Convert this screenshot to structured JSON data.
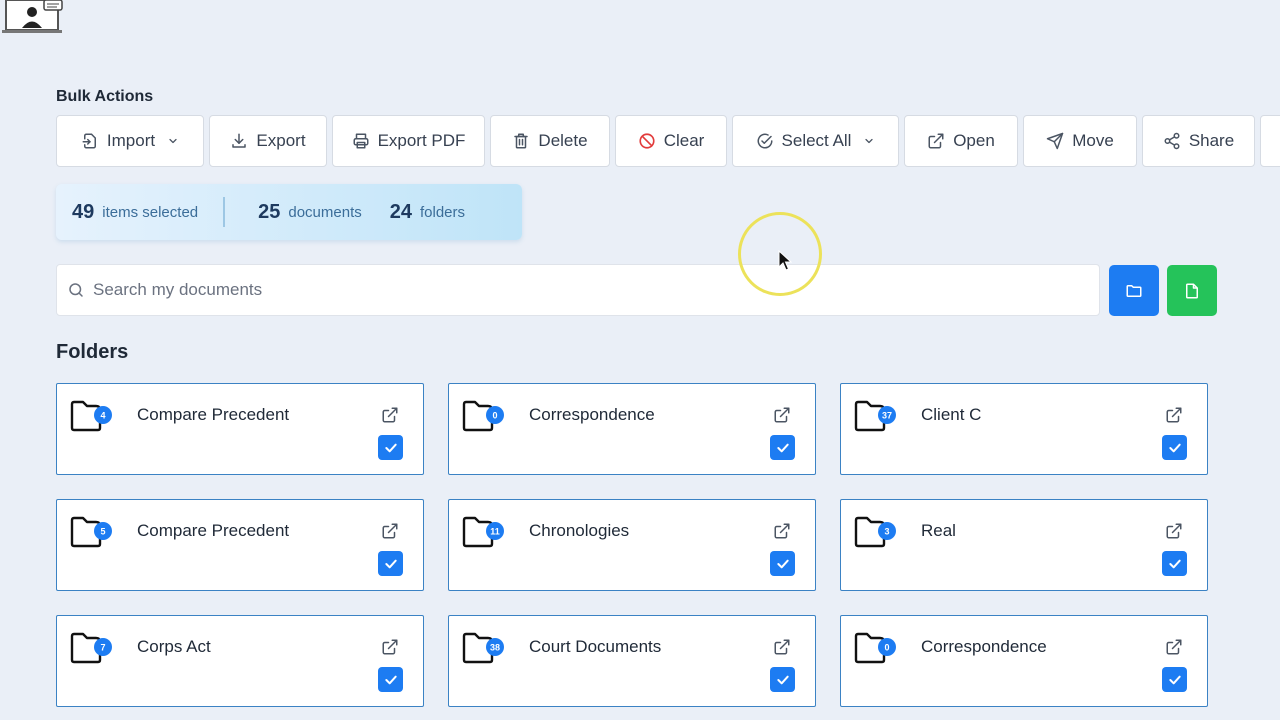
{
  "header": {
    "logo_icon": "presentation-user-icon"
  },
  "bulk_actions": {
    "title": "Bulk Actions",
    "buttons": [
      {
        "label": "Import",
        "icon": "file-import-icon",
        "dropdown": true
      },
      {
        "label": "Export",
        "icon": "download-icon"
      },
      {
        "label": "Export PDF",
        "icon": "printer-icon"
      },
      {
        "label": "Delete",
        "icon": "trash-icon"
      },
      {
        "label": "Clear",
        "icon": "ban-icon",
        "icon_color": "#e23b3b"
      },
      {
        "label": "Select All",
        "icon": "check-circle-icon",
        "dropdown": true
      },
      {
        "label": "Open",
        "icon": "external-link-icon"
      },
      {
        "label": "Move",
        "icon": "send-icon"
      },
      {
        "label": "Share",
        "icon": "share-icon"
      }
    ]
  },
  "selection_summary": {
    "items_count": "49",
    "items_label": "items selected",
    "documents_count": "25",
    "documents_label": "documents",
    "folders_count": "24",
    "folders_label": "folders"
  },
  "search": {
    "placeholder": "Search my documents",
    "value": ""
  },
  "actions": {
    "new_folder_icon": "folder-icon",
    "new_document_icon": "file-icon",
    "folder_color": "#1d7cf2",
    "document_color": "#25c35a"
  },
  "folders": {
    "title": "Folders",
    "items": [
      {
        "name": "Compare Precedent",
        "count": "4",
        "selected": true
      },
      {
        "name": "Correspondence",
        "count": "0",
        "selected": true
      },
      {
        "name": "Client C",
        "count": "37",
        "selected": true
      },
      {
        "name": "Compare Precedent",
        "count": "5",
        "selected": true
      },
      {
        "name": "Chronologies",
        "count": "11",
        "selected": true
      },
      {
        "name": "Real",
        "count": "3",
        "selected": true
      },
      {
        "name": "Corps Act",
        "count": "7",
        "selected": true
      },
      {
        "name": "Court Documents",
        "count": "38",
        "selected": true
      },
      {
        "name": "Correspondence",
        "count": "0",
        "selected": true
      }
    ]
  },
  "colors": {
    "accent": "#1d7cf2",
    "card_border": "#3b82c4",
    "background": "#eaeff7"
  }
}
